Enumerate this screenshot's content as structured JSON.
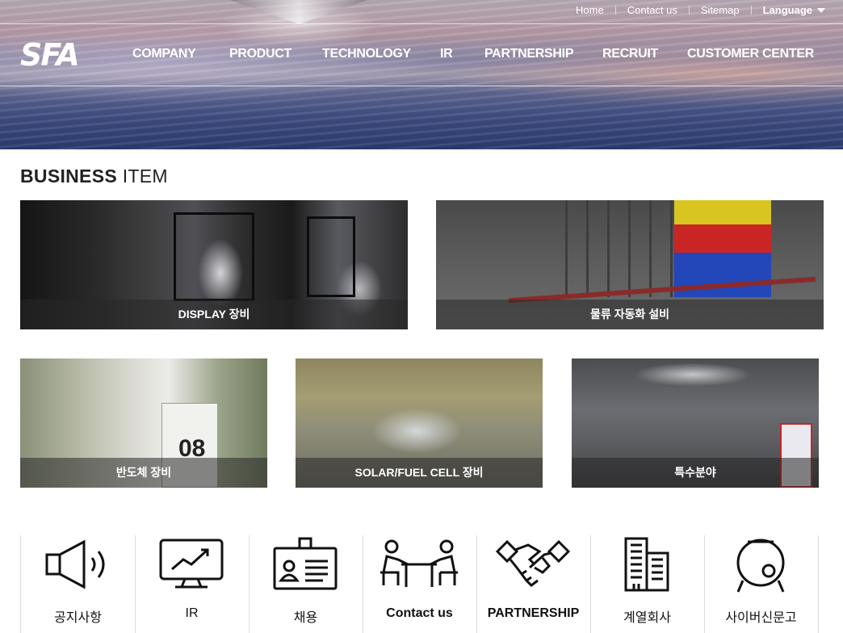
{
  "utility_nav": [
    "Home",
    "Contact us",
    "Sitemap"
  ],
  "language_label": "Language",
  "logo_text": "SFA",
  "gnb": [
    "COMPANY",
    "PRODUCT",
    "TECHNOLOGY",
    "IR",
    "PARTNERSHIP",
    "RECRUIT",
    "CUSTOMER CENTER"
  ],
  "business": {
    "title_bold": "BUSINESS",
    "title_light": "ITEM",
    "items": [
      "DISPLAY 장비",
      "물류 자동화 설비",
      "반도체 장비",
      "SOLAR/FUEL CELL 장비",
      "특수분야"
    ],
    "image_text": {
      "machine_number": "08"
    }
  },
  "quick_menu": [
    {
      "label": "공지사항",
      "icon": "speaker-icon"
    },
    {
      "label": "IR",
      "icon": "monitor-chart-icon"
    },
    {
      "label": "채용",
      "icon": "id-card-icon"
    },
    {
      "label": "Contact us",
      "icon": "meeting-icon"
    },
    {
      "label": "PARTNERSHIP",
      "icon": "handshake-icon"
    },
    {
      "label": "계열회사",
      "icon": "buildings-icon"
    },
    {
      "label": "사이버신문고",
      "icon": "drum-icon"
    }
  ]
}
